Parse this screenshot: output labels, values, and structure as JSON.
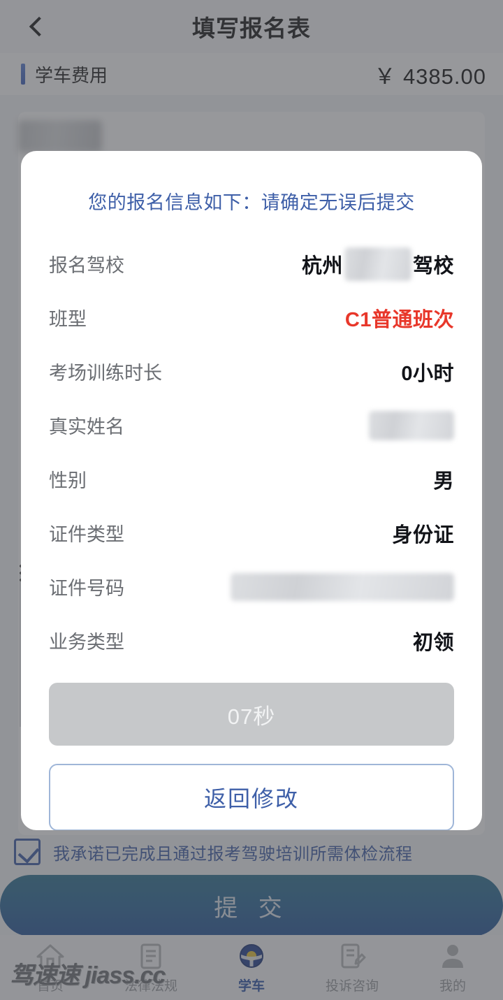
{
  "header": {
    "title": "填写报名表",
    "back_icon": "chevron-left-icon"
  },
  "fee_bar": {
    "label": "学车费用",
    "amount": "￥ 4385.00",
    "accent_color": "#4a6ec8"
  },
  "modal": {
    "title": "您的报名信息如下：请确定无误后提交",
    "title_color": "#3e5fa8",
    "rows": [
      {
        "label": "报名驾校",
        "value_prefix": "杭州",
        "value_suffix": "驾校",
        "masked": true,
        "mask_kind": "school"
      },
      {
        "label": "班型",
        "value": "C1普通班次",
        "highlight": true,
        "highlight_color": "#e8372a"
      },
      {
        "label": "考场训练时长",
        "value": "0小时"
      },
      {
        "label": "真实姓名",
        "value": "",
        "masked": true,
        "mask_kind": "name"
      },
      {
        "label": "性别",
        "value": "男"
      },
      {
        "label": "证件类型",
        "value": "身份证"
      },
      {
        "label": "证件号码",
        "value": "",
        "masked": true,
        "mask_kind": "id"
      },
      {
        "label": "业务类型",
        "value": "初领"
      }
    ],
    "countdown_button": {
      "label": "07秒",
      "disabled": true
    },
    "back_edit_button": {
      "label": "返回修改"
    }
  },
  "promise": {
    "checked": true,
    "text": "我承诺已完成且通过报考驾驶培训所需体检流程",
    "color": "#3e5fa8"
  },
  "submit": {
    "label": "提 交",
    "color_start": "#2e7392",
    "color_end": "#27559a"
  },
  "tabbar": {
    "items": [
      {
        "label": "首页",
        "icon": "home-icon",
        "active": false
      },
      {
        "label": "法律法规",
        "icon": "document-icon",
        "active": false
      },
      {
        "label": "学车",
        "icon": "steering-wheel-icon",
        "active": true
      },
      {
        "label": "投诉咨询",
        "icon": "feedback-icon",
        "active": false
      },
      {
        "label": "我的",
        "icon": "person-icon",
        "active": false
      }
    ],
    "active_color": "#2f54a8",
    "inactive_color": "#9a9c9f"
  },
  "watermark": {
    "text": "驾速速 jiass.cc"
  }
}
